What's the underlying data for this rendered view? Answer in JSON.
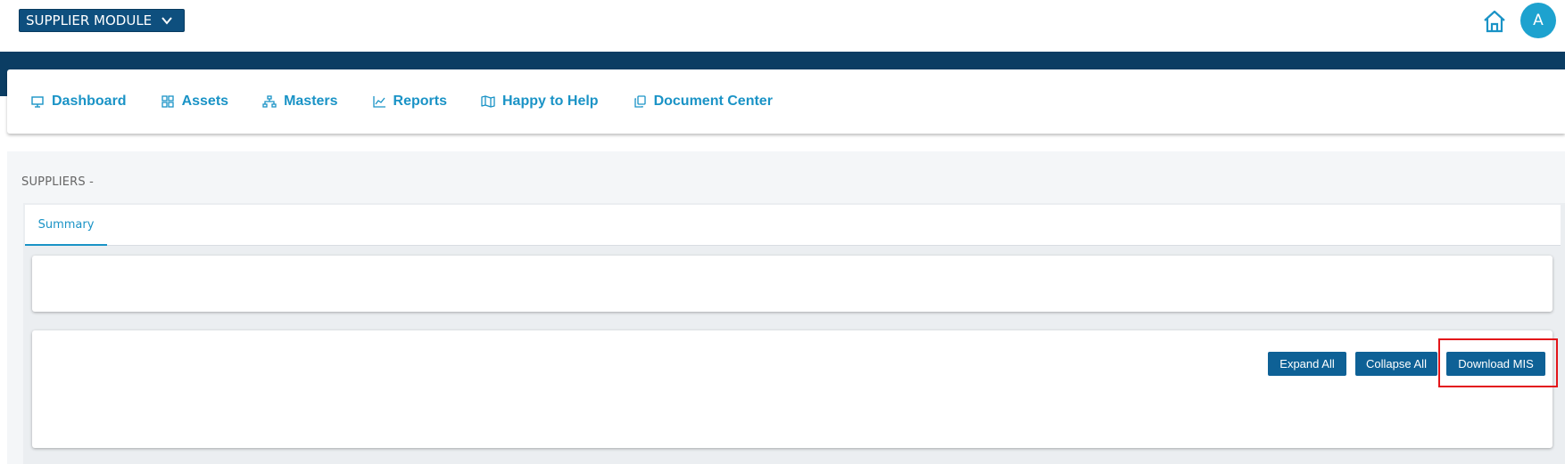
{
  "header": {
    "module_label": "SUPPLIER MODULE",
    "avatar_initial": "A"
  },
  "nav": {
    "items": [
      {
        "label": "Dashboard",
        "icon": "monitor-icon"
      },
      {
        "label": "Assets",
        "icon": "grid-icon"
      },
      {
        "label": "Masters",
        "icon": "sitemap-icon"
      },
      {
        "label": "Reports",
        "icon": "chart-line-icon"
      },
      {
        "label": "Happy to Help",
        "icon": "map-icon"
      },
      {
        "label": "Document Center",
        "icon": "copy-icon"
      }
    ]
  },
  "page": {
    "title": "SUPPLIERS -"
  },
  "tabs": [
    {
      "label": "Summary",
      "active": true
    }
  ],
  "actions": {
    "expand_all": "Expand All",
    "collapse_all": "Collapse All",
    "download_mis": "Download MIS"
  },
  "colors": {
    "brand_dark": "#0b3d63",
    "accent": "#1a93c6",
    "button": "#0e6196",
    "highlight": "#e3151a"
  }
}
